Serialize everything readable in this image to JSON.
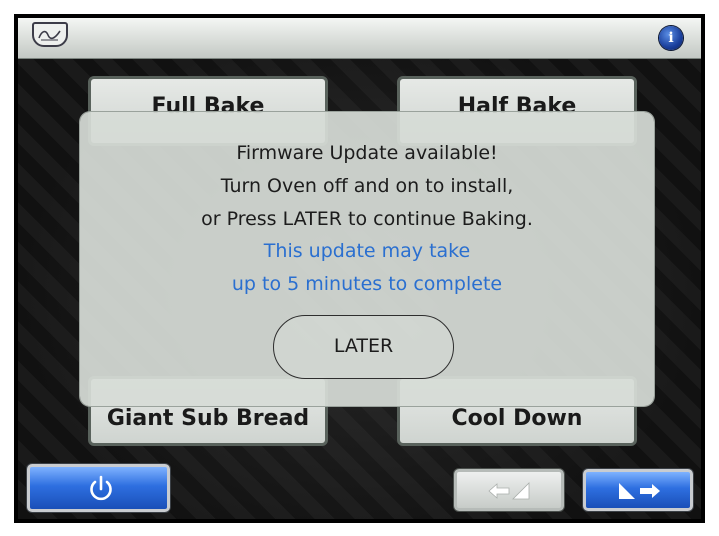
{
  "header": {
    "logo_icon": "brand-shield-logo",
    "info_icon": "info-icon",
    "info_glyph": "i"
  },
  "menu": {
    "full_bake": "Full Bake",
    "half_bake": "Half Bake",
    "giant_sub_bread": "Giant Sub Bread",
    "cool_down": "Cool Down"
  },
  "dialog": {
    "line1": "Firmware Update available!",
    "line2": "Turn Oven off and on to install,",
    "line3": "or Press LATER to continue Baking.",
    "line4": "This update may take",
    "line5": "up to 5 minutes to complete",
    "later_label": "LATER",
    "accent_color": "#2a6fd0"
  },
  "footer": {
    "power_icon": "power-icon",
    "prev_icon": "arrow-left-icon",
    "next_icon": "arrow-right-icon"
  }
}
